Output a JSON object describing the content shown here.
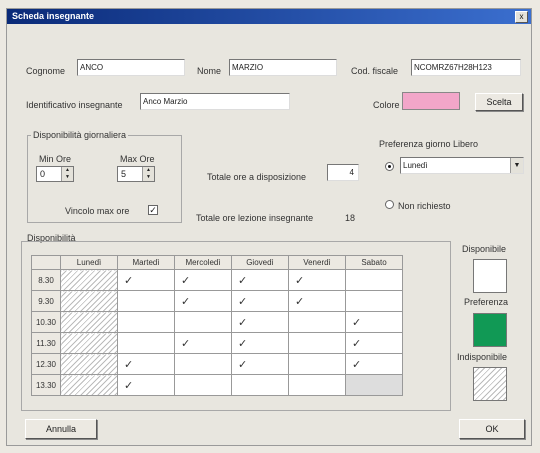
{
  "window": {
    "title": "Scheda insegnante",
    "close_symbol": "x"
  },
  "fields": {
    "cognome_label": "Cognome",
    "cognome_value": "ANCO",
    "nome_label": "Nome",
    "nome_value": "MARZIO",
    "codfiscale_label": "Cod. fiscale",
    "codfiscale_value": "NCOMRZ67H28H123",
    "identificativo_label": "Identificativo insegnante",
    "identificativo_value": "Anco Marzio",
    "colore_label": "Colore",
    "colore_value": "#f2a6c9",
    "scelta_button": "Scelta"
  },
  "disponibilita_giornaliera": {
    "title": "Disponibilità giornaliera",
    "min_label": "Min Ore",
    "min_value": "0",
    "max_label": "Max Ore",
    "max_value": "5",
    "vincolo_label": "Vincolo max ore",
    "vincolo_checked": "✓"
  },
  "totali": {
    "ore_disposizione_label": "Totale ore a disposizione",
    "ore_disposizione_value": "4",
    "ore_lezione_label": "Totale ore lezione insegnante",
    "ore_lezione_value": "18"
  },
  "preferenza": {
    "title": "Preferenza giorno Libero",
    "selected": "Lunedì",
    "non_richiesto_label": "Non richiesto"
  },
  "grid": {
    "title": "Disponibilità",
    "days": [
      "Lunedì",
      "Martedì",
      "Mercoledì",
      "Giovedì",
      "Venerdì",
      "Sabato"
    ],
    "rows": [
      {
        "time": "8.30",
        "cells": [
          "H",
          "✓",
          "✓",
          "✓",
          "✓",
          ""
        ]
      },
      {
        "time": "9.30",
        "cells": [
          "H",
          "",
          "✓",
          "✓",
          "✓",
          ""
        ]
      },
      {
        "time": "10.30",
        "cells": [
          "H",
          "",
          "",
          "✓",
          "",
          "✓"
        ]
      },
      {
        "time": "11.30",
        "cells": [
          "H",
          "",
          "✓",
          "✓",
          "",
          "✓"
        ]
      },
      {
        "time": "12.30",
        "cells": [
          "H",
          "✓",
          "",
          "✓",
          "",
          "✓"
        ]
      },
      {
        "time": "13.30",
        "cells": [
          "H",
          "✓",
          "",
          "",
          "",
          "G"
        ]
      }
    ]
  },
  "legend": {
    "disponibile": "Disponibile",
    "preferenza": "Preferenza",
    "indisponibile": "Indisponibile",
    "preferenza_color": "#119955"
  },
  "buttons": {
    "annulla": "Annulla",
    "ok": "OK"
  }
}
